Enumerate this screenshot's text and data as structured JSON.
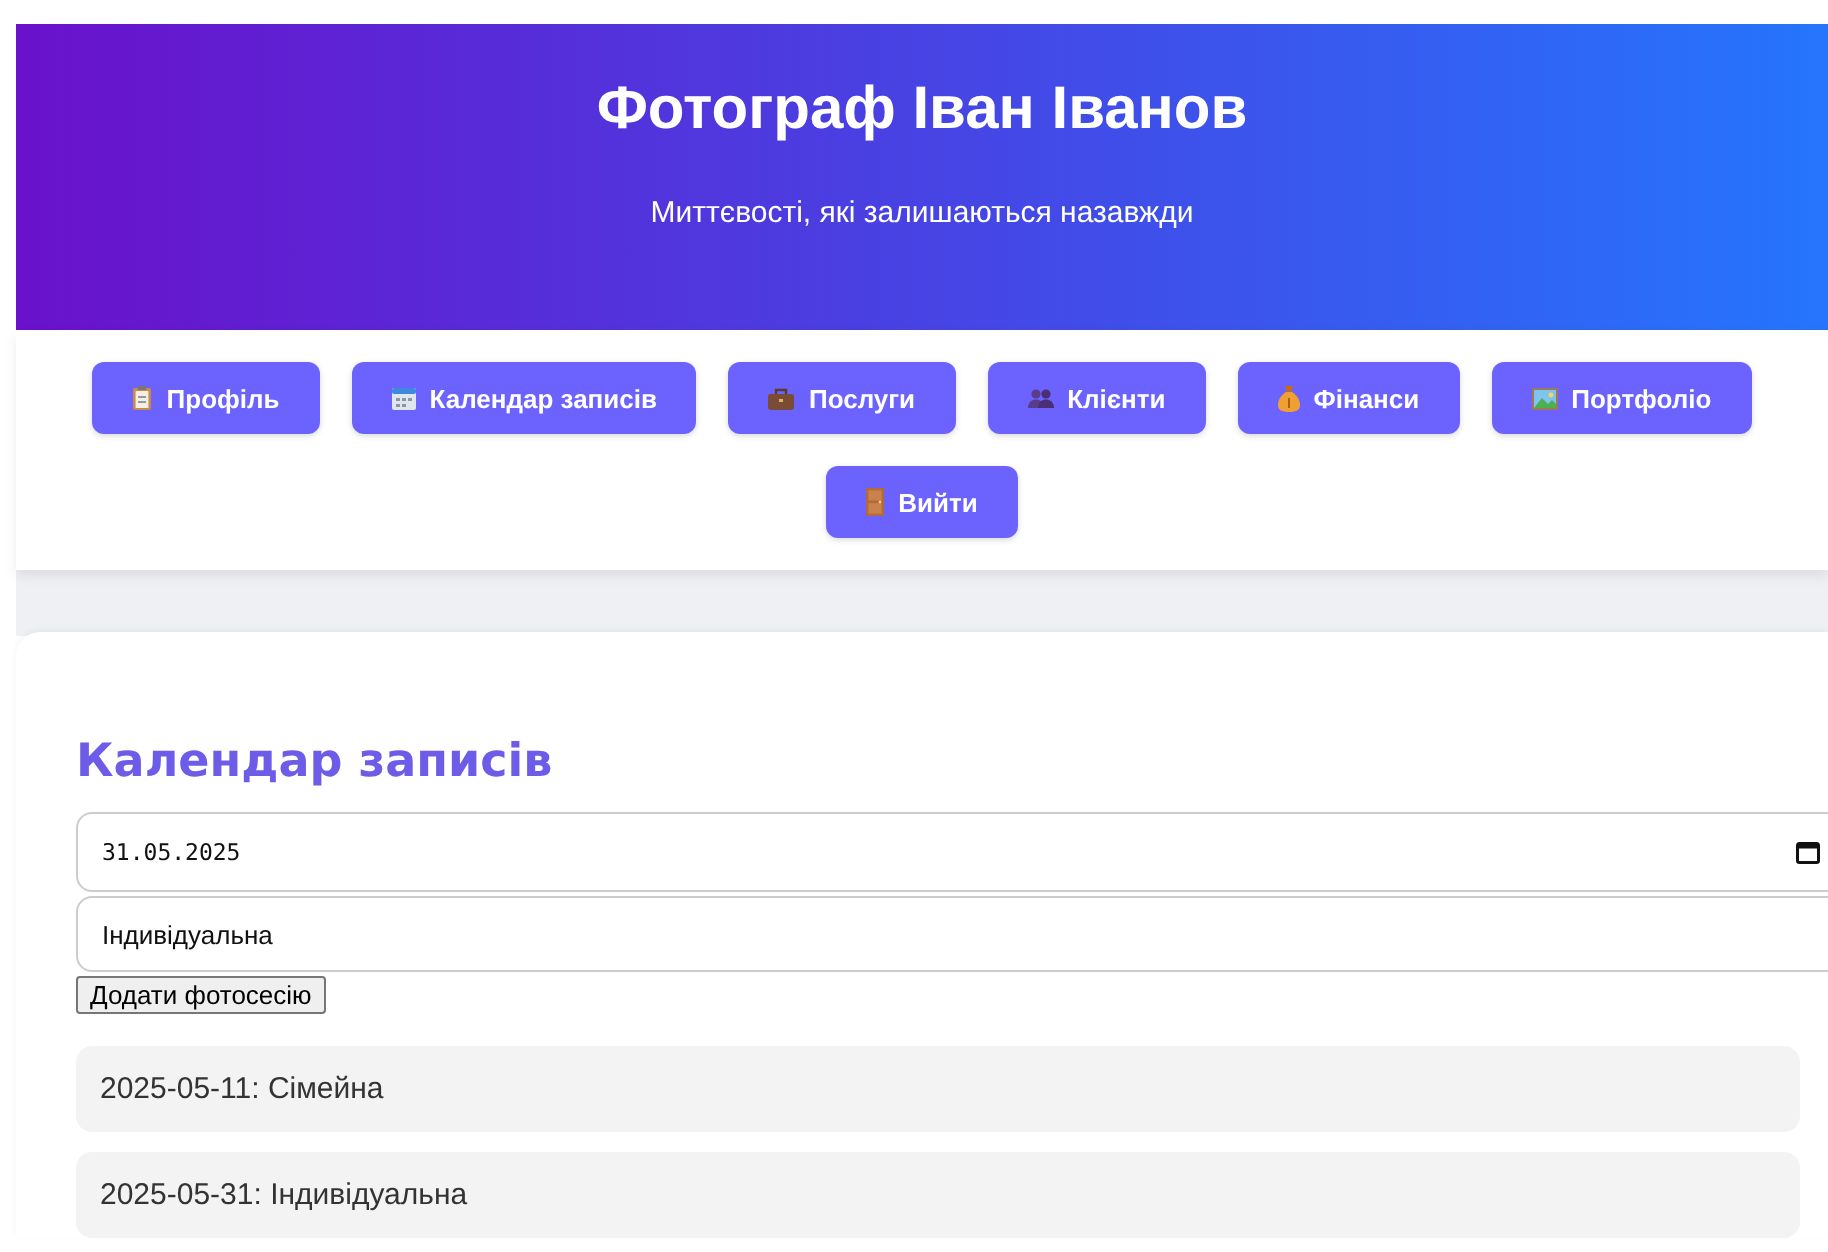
{
  "header": {
    "title": "Фотограф Іван Іванов",
    "tagline": "Миттєвості, які залишаються назавжди"
  },
  "nav": [
    {
      "label": "Профіль"
    },
    {
      "label": "Календар записів"
    },
    {
      "label": "Послуги"
    },
    {
      "label": "Клієнти"
    },
    {
      "label": "Фінанси"
    },
    {
      "label": "Портфоліо"
    },
    {
      "label": "Вийти"
    }
  ],
  "section": {
    "title": "Календар записів",
    "date_value": "31.05.2025",
    "type_value": "Індивідуальна",
    "add_button": "Додати фотосесію"
  },
  "sessions": [
    {
      "text": "2025-05-11: Сімейна"
    },
    {
      "text": "2025-05-31: Індивідуальна"
    }
  ]
}
